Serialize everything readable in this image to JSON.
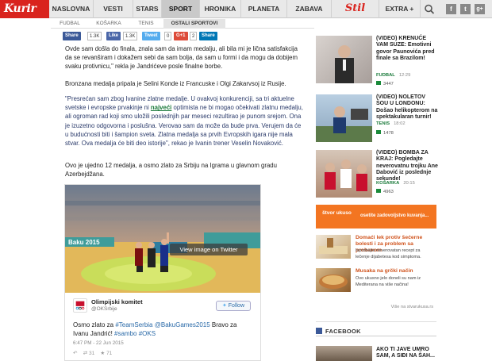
{
  "nav": {
    "logo": "Kurir",
    "tabs": [
      "NASLOVNA",
      "VESTI",
      "STARS",
      "SPORT",
      "HRONIKA",
      "PLANETA",
      "ZABAVA"
    ],
    "active_tab": "SPORT",
    "stil": "Stil",
    "extra": "EXTRA +",
    "social": [
      "f",
      "t",
      "g+"
    ]
  },
  "subnav": {
    "tabs": [
      "FUDBAL",
      "KOŠARKA",
      "TENIS",
      "OSTALI SPORTOVI"
    ],
    "active_tab": "OSTALI SPORTOVI"
  },
  "share": {
    "facebook_label": "Share",
    "facebook_count": "1.3K",
    "like_label": "Like",
    "like_count": "1.3K",
    "tweet_label": "Tweet",
    "tweet_count": "0",
    "gplus_label": "G+1",
    "gplus_count": "2",
    "share_label": "Share"
  },
  "article": {
    "p1": "Ovde sam došla do finala, znala sam da imam medalju, ali bila mi je ličnа satisfakcija da se revanširam i dokažem sebi da sam bolja, da sam u formi i da mogu da dobijem svaku protivnicu,\" rekla je Jandrićeve posle finalne borbe.",
    "p2": "Bronzana medalja pripala je Selini Konde iz Francuske i Olgi Zakarvsoj iz Rusije.",
    "p3_before": "\"Presrećan sam zbog Ivanine zlatne medalje. U ovakvoj konkurenciji, sa tri aktuelne svetske i evropske prvakinje ni ",
    "p3_link": "najveći",
    "p3_after": " optimista ne bi mogao očekivati zlatnu medalju, ali ogroman rad koji smo uložili poslednjih par meseci rezultirao je punom srejom. Ona je izuzetno odgovorna i poslušna. Verovao sam da može da bude prva. Verujem da će u budućnosti biti i šampion sveta. Zlatna medalja sa prvih Evropskih igara nije mala stvar. Ova medalja će biti deo istorije\", rekao je Ivanin trener Veselin Novaković.",
    "p4": "Ovo je ujedno 12 medalja, a osmo zlato za Srbiju na Igrama u glavnom gradu Azerbejdžana."
  },
  "tweet": {
    "image_banner": "Baku 2015",
    "view_button": "View image on Twitter",
    "account_name": "Olimpijski komitet",
    "handle": "@OKSrbije",
    "follow": "Follow",
    "text_prefix": "Osmo zlato za ",
    "hashtag1": "#TeamSerbia",
    "mention": "@BakuGames2015",
    "text_middle": " Bravo za Ivanu Jandrić! ",
    "hashtag2": "#sambo",
    "hashtag3": "#OKS",
    "date": "6:47 PM - 22 Jun 2015",
    "retweets": "31",
    "favorites": "71"
  },
  "sidebar": {
    "items": [
      {
        "title": "(VIDEO) KRENUĆE VAM SUZE: Emotivni govor Paunovića pred finale sa Brazilom!",
        "category": "FUDBAL",
        "time": "12:29",
        "count": "3447"
      },
      {
        "title": "(VIDEO) NOLETOV ŠOU U LONDONU: Došao helikopterom na spektakularan turnir!",
        "category": "TENIS",
        "time": "18:02",
        "count": "1478"
      },
      {
        "title": "(VIDEO) BOMBA ZA KRAJ: Pogledajte neverovatnu trojku Ane Dabović iz poslednje sekunde!",
        "category": "KOŠARKA",
        "time": "20:15",
        "count": "4963"
      }
    ]
  },
  "promo": {
    "brand": "štvor ukuso",
    "text": "osetite zadovoljstvo kuvanja..."
  },
  "recipes": [
    {
      "title": "Domaći lek protiv šećerne bolesti i za problem sa probavom",
      "desc": "Isprobajte neverovatan recept za lečenje dijabetesa kod simptoma."
    },
    {
      "title": "Musaka na grčki način",
      "desc": "Ovo ukusno jelo doneli su nam iz Mediterana na više načina!"
    }
  ],
  "recipe_footer": "Više na stvarukusa.rs",
  "facebook": {
    "heading": "FACEBOOK",
    "post_title": "AKO TI JAVE UMRO SAM, A SIĐI NA ŠAH..."
  }
}
